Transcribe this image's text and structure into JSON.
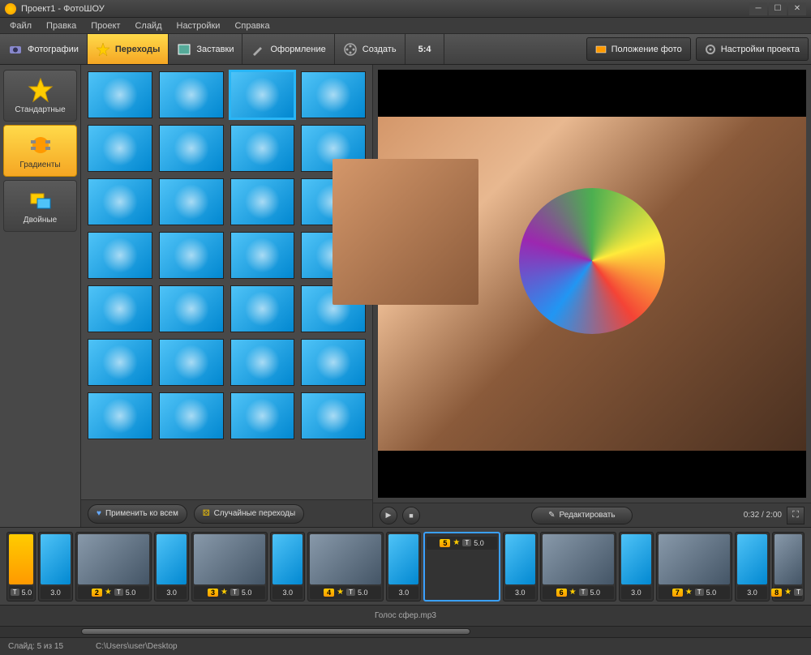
{
  "window": {
    "title": "Проект1 - ФотоШОУ"
  },
  "menu": [
    "Файл",
    "Правка",
    "Проект",
    "Слайд",
    "Настройки",
    "Справка"
  ],
  "tabs": [
    {
      "label": "Фотографии",
      "icon": "camera"
    },
    {
      "label": "Переходы",
      "icon": "star",
      "active": true
    },
    {
      "label": "Заставки",
      "icon": "picture"
    },
    {
      "label": "Оформление",
      "icon": "brush"
    },
    {
      "label": "Создать",
      "icon": "reel"
    }
  ],
  "ratio": "5:4",
  "rightButtons": {
    "position": "Положение фото",
    "settings": "Настройки проекта"
  },
  "categories": [
    {
      "label": "Стандартные",
      "icon": "star"
    },
    {
      "label": "Градиенты",
      "icon": "gradient",
      "active": true
    },
    {
      "label": "Двойные",
      "icon": "double"
    }
  ],
  "galleryCount": 28,
  "gallerySelectedIndex": 2,
  "galleryButtons": {
    "applyAll": "Применить ко всем",
    "random": "Случайные переходы"
  },
  "preview": {
    "edit": "Редактировать",
    "time": "0:32 / 2:00"
  },
  "timeline": [
    {
      "type": "slide",
      "num": "",
      "duration": "5.0",
      "thumb": "yellow",
      "partial": true
    },
    {
      "type": "trans",
      "duration": "3.0"
    },
    {
      "type": "slide",
      "num": "2",
      "duration": "5.0",
      "thumb": "photo1"
    },
    {
      "type": "trans",
      "duration": "3.0"
    },
    {
      "type": "slide",
      "num": "3",
      "duration": "5.0",
      "thumb": "photo1"
    },
    {
      "type": "trans",
      "duration": "3.0"
    },
    {
      "type": "slide",
      "num": "4",
      "duration": "5.0",
      "thumb": "photo1"
    },
    {
      "type": "trans",
      "duration": "3.0"
    },
    {
      "type": "slide",
      "num": "5",
      "duration": "5.0",
      "thumb": "balloon",
      "selected": true
    },
    {
      "type": "trans",
      "duration": "3.0"
    },
    {
      "type": "slide",
      "num": "6",
      "duration": "5.0",
      "thumb": "photo1"
    },
    {
      "type": "trans",
      "duration": "3.0"
    },
    {
      "type": "slide",
      "num": "7",
      "duration": "5.0",
      "thumb": "photo1"
    },
    {
      "type": "trans",
      "duration": "3.0"
    },
    {
      "type": "slide",
      "num": "8",
      "duration": "",
      "thumb": "photo1",
      "partial": true
    }
  ],
  "audio": "Голос сфер.mp3",
  "status": {
    "slide": "Слайд: 5 из 15",
    "path": "C:\\Users\\user\\Desktop"
  }
}
